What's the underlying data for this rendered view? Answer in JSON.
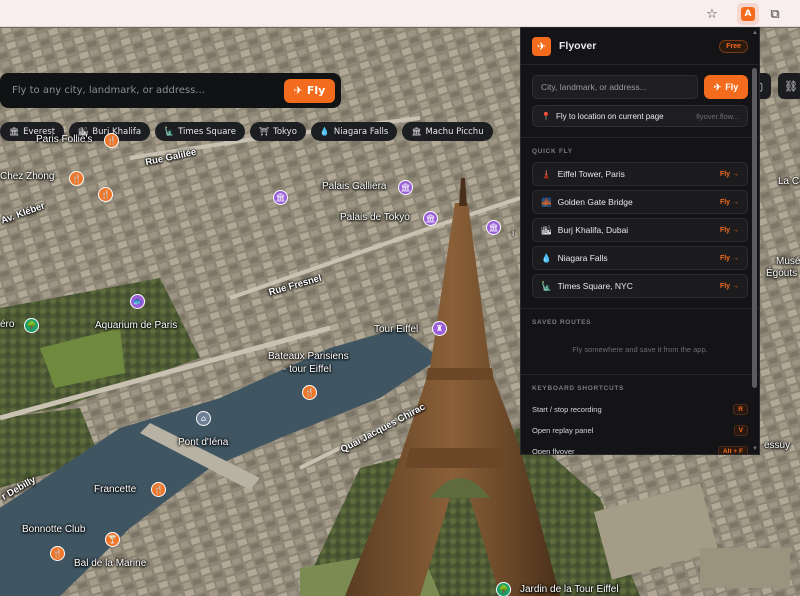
{
  "browser": {
    "ext_badge": "A"
  },
  "map_search": {
    "placeholder": "Fly to any city, landmark, or address...",
    "fly_label": "Fly"
  },
  "chips": [
    {
      "icon": "building-icon",
      "glyph": "🏛",
      "label": "Everest"
    },
    {
      "icon": "tower-icon",
      "glyph": "🏙",
      "label": "Burj Khalifa"
    },
    {
      "icon": "city-icon",
      "glyph": "🗽",
      "label": "Times Square"
    },
    {
      "icon": "temple-icon",
      "glyph": "⛩",
      "label": "Tokyo"
    },
    {
      "icon": "droplet-icon",
      "glyph": "💧",
      "label": "Niagara Falls"
    },
    {
      "icon": "ruins-icon",
      "glyph": "🏛",
      "label": "Machu Picchu"
    }
  ],
  "map_labels": {
    "paris_follies": "Paris Follie's",
    "rue_galilee": "Rue Galilée",
    "chez_zhong": "Chez Zhong",
    "av_kleber": "Av. Kléber",
    "palais_galliera": "Palais Galliera",
    "palais_tokyo": "Palais de Tokyo",
    "la_ce": "La Ce",
    "rue_fresnel": "Rue Fresnel",
    "aquarium": "Aquarium de Paris",
    "ero": "éro",
    "tour_eiffel": "Tour Eiffel",
    "bateaux_1": "Bateaux Parisiens",
    "bateaux_2": "- tour Eiffel",
    "mus": "Musé",
    "egouts": "Égouts",
    "pont_iena": "Pont d'Iéna",
    "quai_chirac": "Quai Jacques Chirac",
    "debilly": "r Debilly",
    "francette": "Francette",
    "bonnotte": "Bonnotte Club",
    "bal_marine": "Bal de la Marine",
    "jardin": "Jardin de la Tour Eiffel",
    "essuy": "essuy",
    "i": "i"
  },
  "panel": {
    "title": "Flyover",
    "badge": "Free",
    "search_placeholder": "City, landmark, or address...",
    "fly_label": "Fly",
    "fly_location_label": "Fly to location on current page",
    "fly_location_host": "flyover.flow...",
    "quick_fly_title": "QUICK FLY",
    "quick_fly": [
      {
        "icon": "tower-icon",
        "glyph": "🗼",
        "label": "Eiffel Tower, Paris",
        "action": "Fly →"
      },
      {
        "icon": "bridge-icon",
        "glyph": "🌉",
        "label": "Golden Gate Bridge",
        "action": "Fly →"
      },
      {
        "icon": "skyline-icon",
        "glyph": "🏙",
        "label": "Burj Khalifa, Dubai",
        "action": "Fly →"
      },
      {
        "icon": "droplet-icon",
        "glyph": "💧",
        "label": "Niagara Falls",
        "action": "Fly →"
      },
      {
        "icon": "statue-icon",
        "glyph": "🗽",
        "label": "Times Square, NYC",
        "action": "Fly →"
      }
    ],
    "saved_title": "SAVED ROUTES",
    "saved_empty": "Fly somewhere and save it from the app.",
    "shortcuts_title": "KEYBOARD SHORTCUTS",
    "shortcuts": [
      {
        "label": "Start / stop recording",
        "key": "R"
      },
      {
        "label": "Open replay panel",
        "key": "V"
      },
      {
        "label": "Open flyover",
        "key": "Alt + F"
      }
    ]
  },
  "colors": {
    "accent": "#f36b1c",
    "panel_bg": "#141416"
  }
}
